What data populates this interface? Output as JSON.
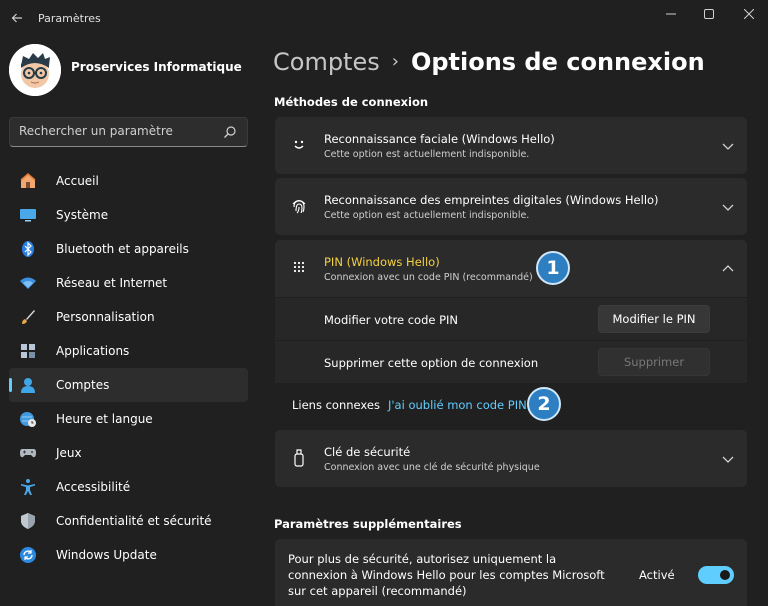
{
  "window": {
    "title": "Paramètres"
  },
  "user": {
    "name": "Proservices Informatique"
  },
  "search": {
    "placeholder": "Rechercher un paramètre"
  },
  "nav": {
    "items": [
      {
        "label": "Accueil",
        "icon": "home-icon"
      },
      {
        "label": "Système",
        "icon": "monitor-icon"
      },
      {
        "label": "Bluetooth et appareils",
        "icon": "bluetooth-icon"
      },
      {
        "label": "Réseau et Internet",
        "icon": "wifi-icon"
      },
      {
        "label": "Personnalisation",
        "icon": "brush-icon"
      },
      {
        "label": "Applications",
        "icon": "apps-icon"
      },
      {
        "label": "Comptes",
        "icon": "account-icon",
        "active": true
      },
      {
        "label": "Heure et langue",
        "icon": "globe-clock-icon"
      },
      {
        "label": "Jeux",
        "icon": "gamepad-icon"
      },
      {
        "label": "Accessibilité",
        "icon": "accessibility-icon"
      },
      {
        "label": "Confidentialité et sécurité",
        "icon": "shield-icon"
      },
      {
        "label": "Windows Update",
        "icon": "update-icon"
      }
    ]
  },
  "breadcrumb": {
    "parent": "Comptes",
    "separator": "›",
    "current": "Options de connexion"
  },
  "sections": {
    "methods_title": "Méthodes de connexion",
    "extra_title": "Paramètres supplémentaires"
  },
  "methods": {
    "face": {
      "title": "Reconnaissance faciale (Windows Hello)",
      "subtitle": "Cette option est actuellement indisponible."
    },
    "fingerprint": {
      "title": "Reconnaissance des empreintes digitales (Windows Hello)",
      "subtitle": "Cette option est actuellement indisponible."
    },
    "pin": {
      "title": "PIN (Windows Hello)",
      "subtitle": "Connexion avec un code PIN (recommandé)",
      "change_label": "Modifier votre code PIN",
      "change_button": "Modifier le PIN",
      "remove_label": "Supprimer cette option de connexion",
      "remove_button": "Supprimer"
    },
    "related": {
      "label": "Liens connexes",
      "link": "J'ai oublié mon code PIN"
    },
    "security_key": {
      "title": "Clé de sécurité",
      "subtitle": "Connexion avec une clé de sécurité physique"
    }
  },
  "annotations": {
    "badge1": "1",
    "badge2": "2"
  },
  "extra": {
    "hello_only_text": "Pour plus de sécurité, autorisez uniquement la connexion à Windows Hello pour les comptes Microsoft sur cet appareil (recommandé)",
    "hello_only_status": "Activé",
    "hello_only_on": true
  },
  "colors": {
    "accent": "#60cdff",
    "pin_title": "#f5d142",
    "badge": "#2e7fc1"
  }
}
